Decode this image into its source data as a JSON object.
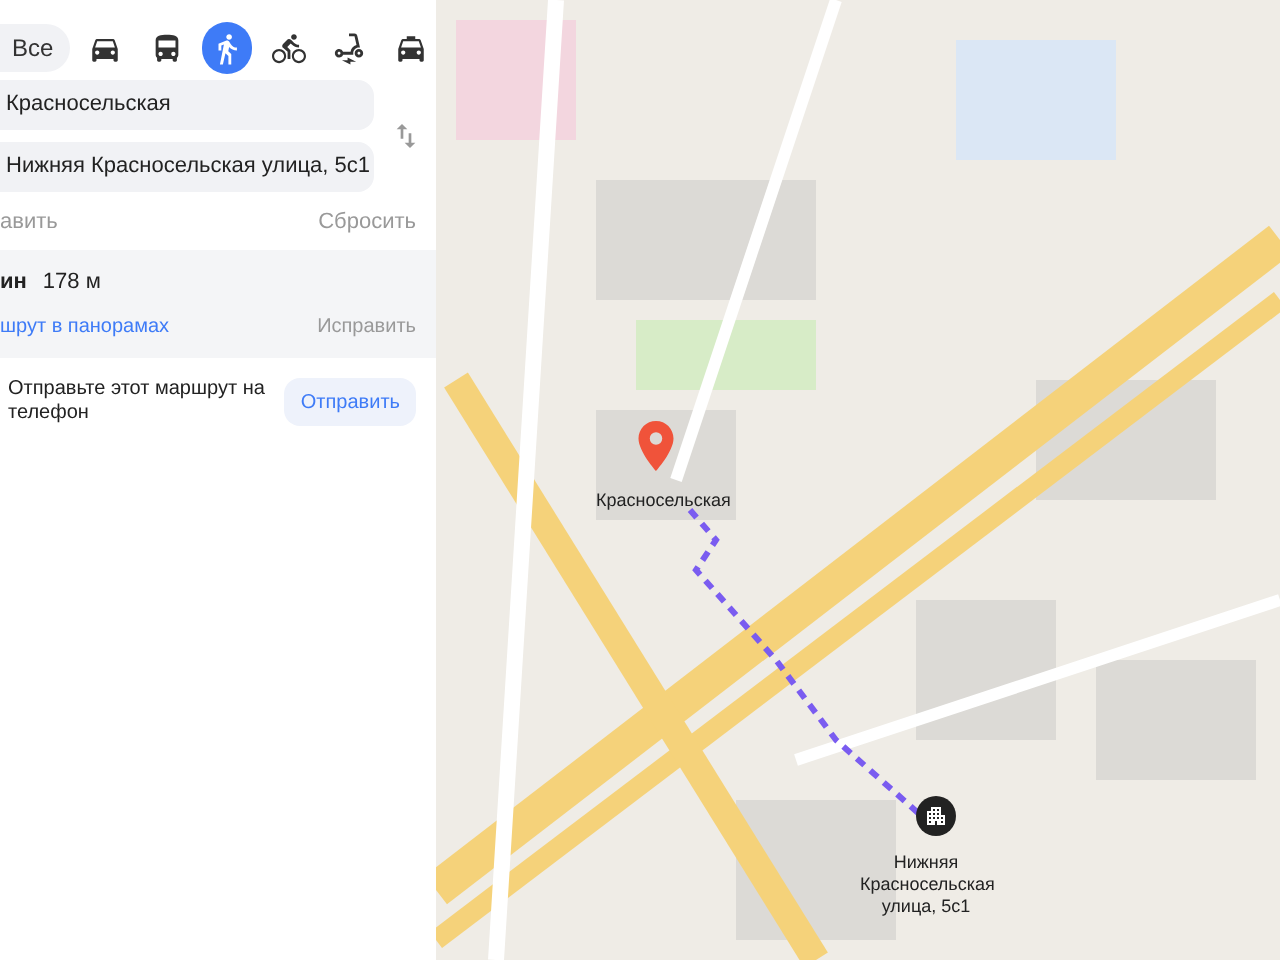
{
  "transport_modes": [
    {
      "kind": "chip",
      "label": "Все",
      "selected": false
    },
    {
      "kind": "car",
      "selected": false
    },
    {
      "kind": "bus",
      "selected": false
    },
    {
      "kind": "walk",
      "selected": true
    },
    {
      "kind": "bike",
      "selected": false
    },
    {
      "kind": "scooter",
      "selected": false
    },
    {
      "kind": "taxi",
      "selected": false
    }
  ],
  "route_from": {
    "value": "Красносельская"
  },
  "route_to": {
    "value": "Нижняя Красносельская улица, 5с1"
  },
  "actions": {
    "add": "авить",
    "reset": "Сбросить"
  },
  "route_summary": {
    "duration": "ин",
    "distance": "178 м",
    "panorama_link": "шрут в панорамах",
    "fix": "Исправить"
  },
  "send_to_phone": {
    "text": "Отправьте этот маршрут на телефон",
    "button": "Отправить"
  },
  "map": {
    "start_label": "Красносельская",
    "end_label": "Нижняя Красносельская улица, 5с1"
  }
}
